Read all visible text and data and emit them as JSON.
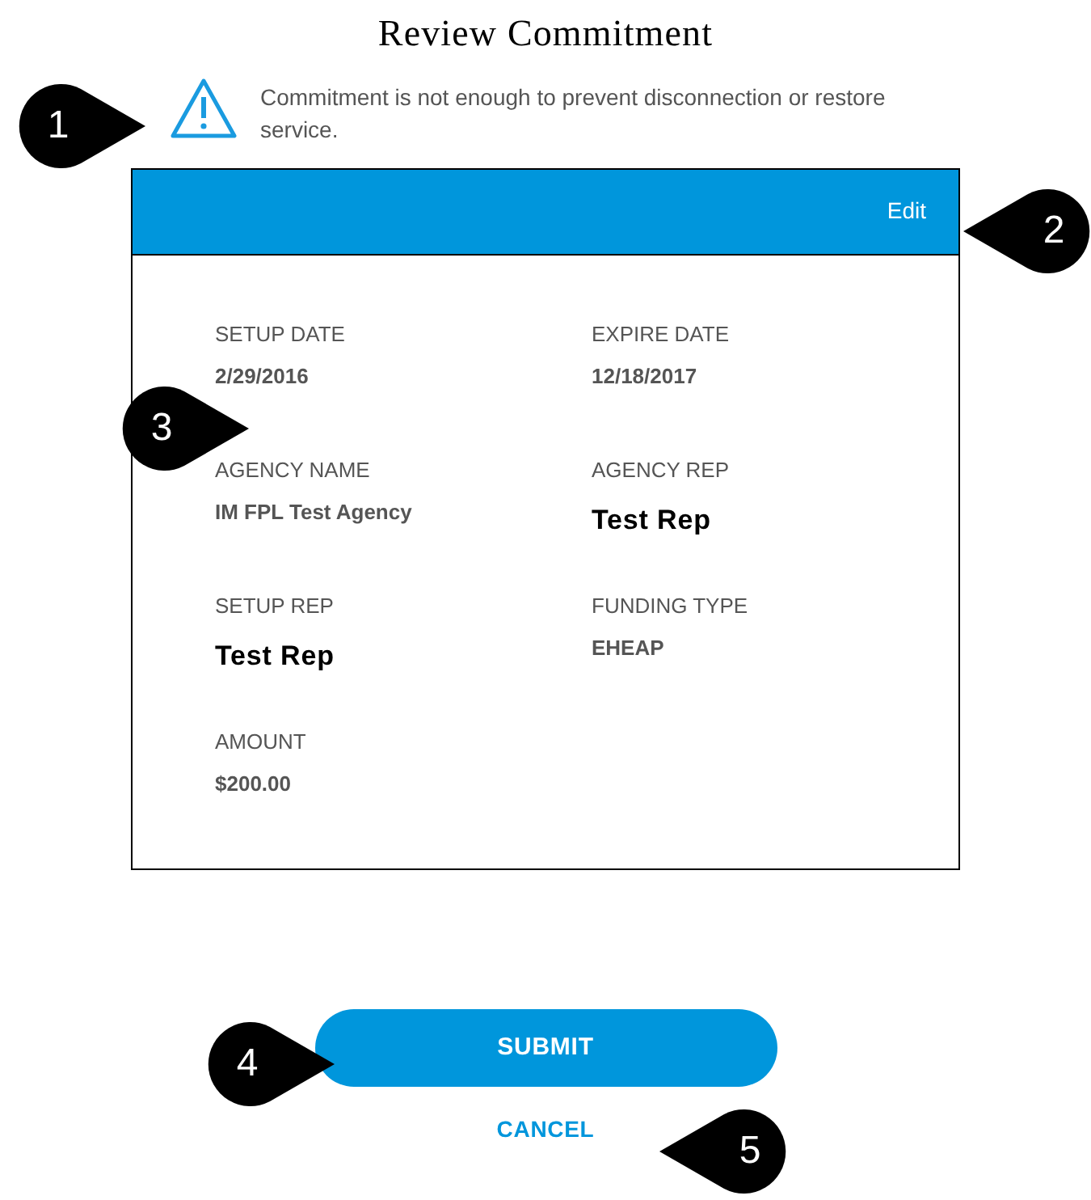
{
  "title": "Review Commitment",
  "warning": {
    "message": "Commitment is not enough to prevent disconnection or restore service."
  },
  "card": {
    "header_action": "Edit",
    "fields": [
      {
        "label": "SETUP DATE",
        "value": "2/29/2016",
        "kind": "plain"
      },
      {
        "label": "EXPIRE DATE",
        "value": "12/18/2017",
        "kind": "plain"
      },
      {
        "label": "AGENCY NAME",
        "value": "IM FPL Test Agency",
        "kind": "plain"
      },
      {
        "label": "AGENCY REP",
        "value": "Test Rep",
        "kind": "strong"
      },
      {
        "label": "SETUP REP",
        "value": "Test Rep",
        "kind": "strong"
      },
      {
        "label": "FUNDING TYPE",
        "value": "EHEAP",
        "kind": "plain"
      },
      {
        "label": "AMOUNT",
        "value": "$200.00",
        "kind": "plain"
      }
    ]
  },
  "buttons": [
    {
      "label": "SUBMIT",
      "kind": "primary"
    },
    {
      "label": "CANCEL",
      "kind": "link"
    }
  ],
  "callouts": [
    {
      "number": "1",
      "kind": "rightward"
    },
    {
      "number": "2",
      "kind": "leftward"
    },
    {
      "number": "3",
      "kind": "rightward"
    },
    {
      "number": "4",
      "kind": "rightward"
    },
    {
      "number": "5",
      "kind": "leftward"
    }
  ]
}
